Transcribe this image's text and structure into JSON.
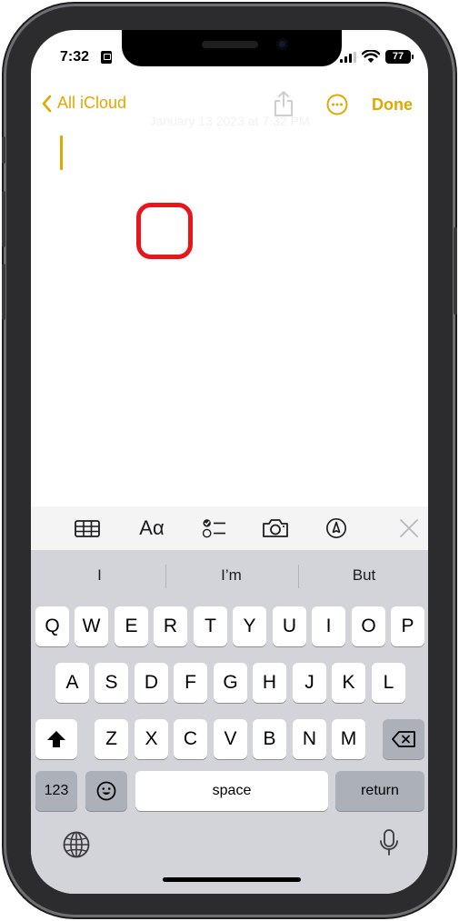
{
  "status": {
    "time": "7:32",
    "battery": "77"
  },
  "nav": {
    "back_label": "All iCloud",
    "done_label": "Done",
    "faint_header": "January 13 2023 at 7:32 PM"
  },
  "toolbar": {
    "format_label": "Aα"
  },
  "suggestions": [
    "I",
    "I’m",
    "But"
  ],
  "keyboard": {
    "row1": [
      "Q",
      "W",
      "E",
      "R",
      "T",
      "Y",
      "U",
      "I",
      "O",
      "P"
    ],
    "row2": [
      "A",
      "S",
      "D",
      "F",
      "G",
      "H",
      "J",
      "K",
      "L"
    ],
    "row3": [
      "Z",
      "X",
      "C",
      "V",
      "B",
      "N",
      "M"
    ],
    "numbers_label": "123",
    "space_label": "space",
    "return_label": "return"
  },
  "colors": {
    "accent": "#e0a800",
    "highlight": "#e8151b",
    "keyboard_bg": "#d3d4d9"
  },
  "icons": [
    "lock-icon",
    "signal-icon",
    "wifi-icon",
    "battery-icon",
    "back-chevron-icon",
    "share-icon",
    "more-icon",
    "table-icon",
    "checklist-icon",
    "camera-icon",
    "markup-icon",
    "close-icon",
    "shift-icon",
    "delete-icon",
    "emoji-icon",
    "globe-icon",
    "mic-icon"
  ]
}
